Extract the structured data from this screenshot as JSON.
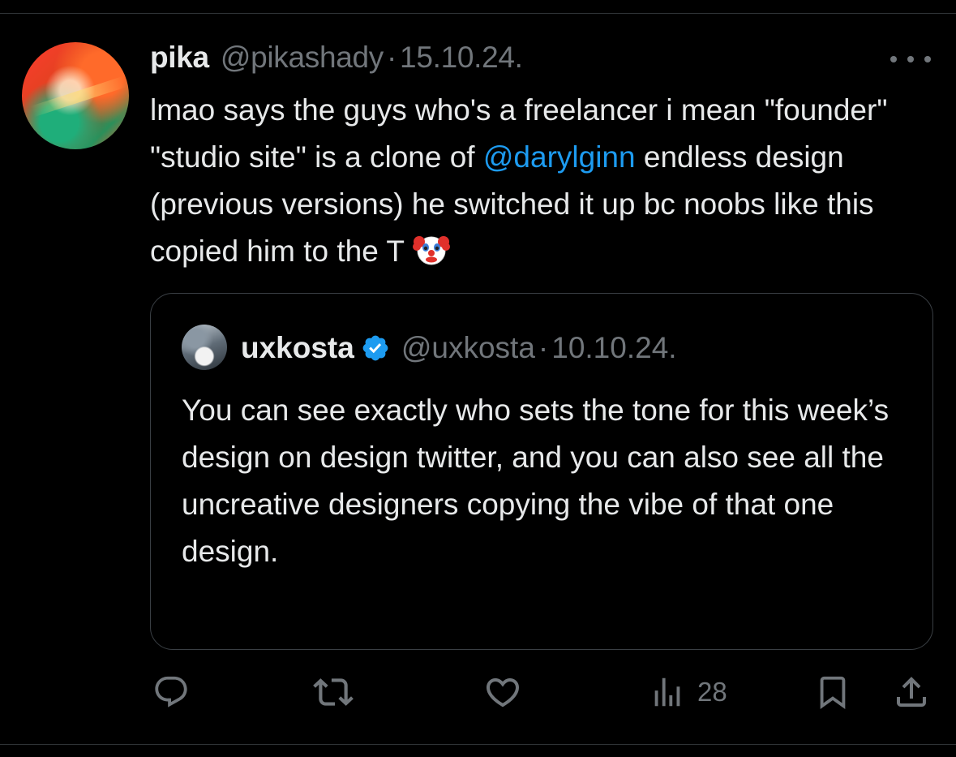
{
  "tweet": {
    "author_name": "pika",
    "handle": "@pikashady",
    "separator": "·",
    "date": "15.10.24.",
    "text_segments": [
      {
        "text": "lmao says the guys who's a freelancer i mean \"founder\" \"studio site\" is a clone of ",
        "type": "text"
      },
      {
        "text": "@darylginn",
        "type": "mention"
      },
      {
        "text": " endless design (previous versions) he switched it up bc noobs like this copied him to the T",
        "type": "text"
      }
    ],
    "emoji": "clown-face",
    "more_icon": "more-horizontal-icon"
  },
  "quoted_tweet": {
    "author_name": "uxkosta",
    "verified": true,
    "handle": "@uxkosta",
    "separator": "·",
    "date": "10.10.24.",
    "text": "You can see exactly who sets the tone for this week’s design on design twitter, and you can also see all the uncreative designers copying the vibe of that one design."
  },
  "actions": {
    "reply_icon": "reply-icon",
    "repost_icon": "repost-icon",
    "like_icon": "like-icon",
    "views_icon": "views-icon",
    "views_count": "28",
    "bookmark_icon": "bookmark-icon",
    "share_icon": "share-icon"
  },
  "colors": {
    "background": "#000000",
    "text": "#e7e9ea",
    "secondary": "#71767b",
    "mention": "#1d9bf0",
    "verified": "#1d9bf0",
    "border": "#2f3336"
  }
}
